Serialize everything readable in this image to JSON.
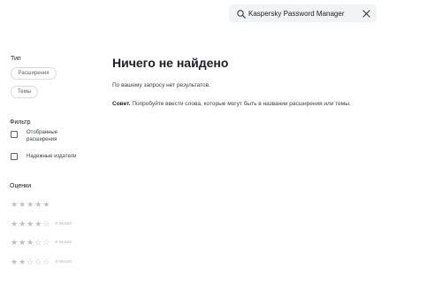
{
  "search": {
    "value": "Kaspersky Password Manager",
    "placeholder": ""
  },
  "sidebar": {
    "type_label": "Тип",
    "chips": [
      {
        "label": "Расширения"
      },
      {
        "label": "Темы"
      }
    ],
    "filter_label": "Фильтр",
    "filters": [
      {
        "label_line1": "Отобранные",
        "label_line2": "расширения",
        "checked": false
      },
      {
        "label_line1": "Надежные издатели",
        "label_line2": "",
        "checked": false
      }
    ],
    "ratings_label": "Оценки",
    "ratings": [
      {
        "stars": 5,
        "suffix": ""
      },
      {
        "stars": 4,
        "suffix": "и выше"
      },
      {
        "stars": 3,
        "suffix": "и выше"
      },
      {
        "stars": 2,
        "suffix": "и выше"
      }
    ]
  },
  "main": {
    "title": "Ничего не найдено",
    "description": "По вашему запросу нет результатов.",
    "tip_bold": "Совет.",
    "tip_text": " Попробуйте ввести слова, которые могут быть в названии расширения или темы."
  }
}
